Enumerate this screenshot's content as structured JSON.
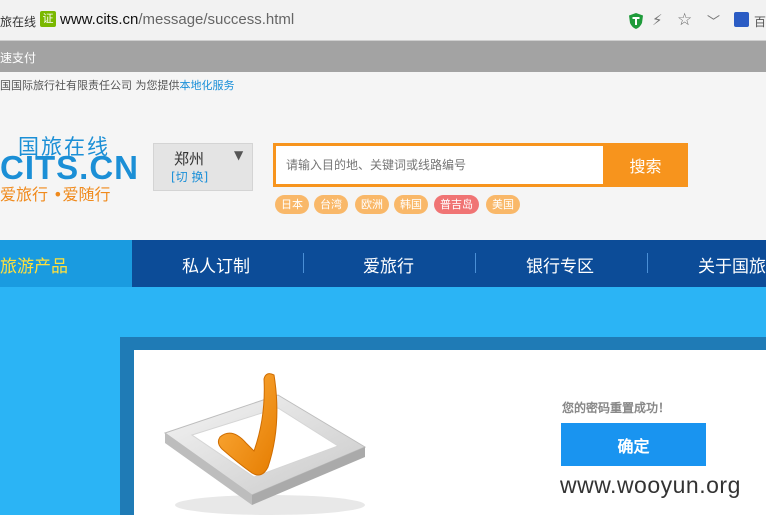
{
  "browser": {
    "tab_title": "旅在线",
    "secure_badge": "证",
    "url_domain": "www.cits.cn",
    "url_path": "/message/success.html",
    "baidu_label": "百"
  },
  "bookmarks_bar": {
    "text": "速支付"
  },
  "top_info": {
    "text": "国国际旅行社有限责任公司 为您提供",
    "link": "本地化服务"
  },
  "logo": {
    "chinese": "国旅在线",
    "english": "CITS.CN",
    "slogan": "爱旅行 •爱随行"
  },
  "city": {
    "name": "郑州",
    "switch_label": "[切 换]",
    "arrow": "▼"
  },
  "search": {
    "placeholder": "请输入目的地、关键词或线路编号",
    "button_label": "搜索"
  },
  "tags": [
    "日本",
    "台湾",
    "欧洲",
    "韩国",
    "普吉岛",
    "美国"
  ],
  "nav": {
    "items": [
      "旅游产品",
      "私人订制",
      "爱旅行",
      "银行专区",
      "关于国旅"
    ]
  },
  "result": {
    "message": "您的密码重置成功！",
    "confirm_label": "确定"
  },
  "watermark": "www.wooyun.org",
  "colors": {
    "brand_blue": "#1b8fd6",
    "orange": "#f7941d",
    "nav_bg": "#0c4c98",
    "nav_active": "#1a9be0",
    "content_bg": "#2bb4f5",
    "confirm_button": "#1994f0"
  }
}
